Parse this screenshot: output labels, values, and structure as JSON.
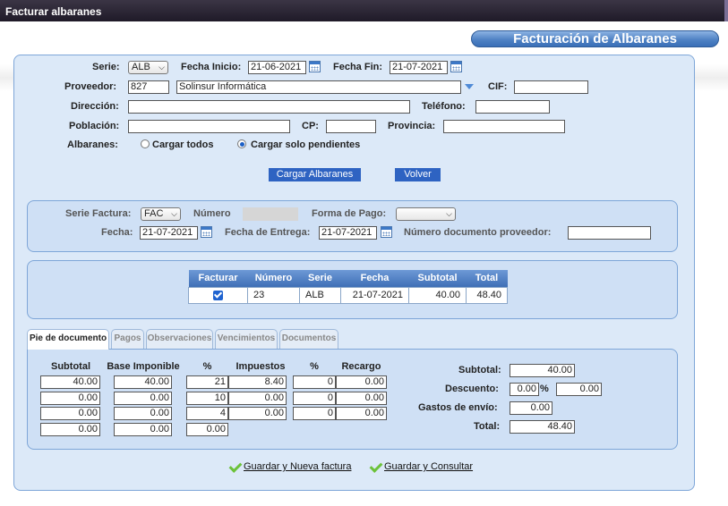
{
  "window": {
    "title": "Facturar albaranes"
  },
  "header": {
    "title": "Facturación de Albaranes"
  },
  "filters": {
    "serie_label": "Serie:",
    "serie_value": "ALB",
    "fecha_inicio_label": "Fecha Inicio:",
    "fecha_inicio": "21-06-2021",
    "fecha_fin_label": "Fecha Fin:",
    "fecha_fin": "21-07-2021",
    "proveedor_label": "Proveedor:",
    "proveedor_code": "827",
    "proveedor_name": "Solinsur Informática",
    "cif_label": "CIF:",
    "cif": "",
    "direccion_label": "Dirección:",
    "direccion": "",
    "telefono_label": "Teléfono:",
    "telefono": "",
    "poblacion_label": "Población:",
    "poblacion": "",
    "cp_label": "CP:",
    "cp": "",
    "provincia_label": "Provincia:",
    "provincia": "",
    "albaranes_label": "Albaranes:",
    "radio_todos": "Cargar todos",
    "radio_pendientes": "Cargar solo pendientes",
    "selected_radio": "pendientes",
    "cargar_button": "Cargar Albaranes",
    "volver_button": "Volver"
  },
  "invoice": {
    "serie_factura_label": "Serie Factura:",
    "serie_factura": "FAC",
    "numero_label": "Número",
    "forma_pago_label": "Forma de Pago:",
    "forma_pago": "",
    "fecha_label": "Fecha:",
    "fecha": "21-07-2021",
    "fecha_entrega_label": "Fecha de Entrega:",
    "fecha_entrega": "21-07-2021",
    "num_doc_label": "Número documento proveedor:",
    "num_doc": ""
  },
  "albaranes_table": {
    "headers": [
      "Facturar",
      "Número",
      "Serie",
      "Fecha",
      "Subtotal",
      "Total"
    ],
    "rows": [
      {
        "facturar": true,
        "numero": "23",
        "serie": "ALB",
        "fecha": "21-07-2021",
        "subtotal": "40.00",
        "total": "48.40"
      }
    ]
  },
  "tabs": [
    "Pie de documento",
    "Pagos",
    "Observaciones",
    "Vencimientos",
    "Documentos"
  ],
  "active_tab": 0,
  "pie": {
    "headers": [
      "Subtotal",
      "Base Imponible",
      "%",
      "Impuestos",
      "%",
      "Recargo"
    ],
    "rows": [
      [
        "40.00",
        "40.00",
        "21",
        "8.40",
        "0",
        "0.00"
      ],
      [
        "0.00",
        "0.00",
        "10",
        "0.00",
        "0",
        "0.00"
      ],
      [
        "0.00",
        "0.00",
        "4",
        "0.00",
        "0",
        "0.00"
      ]
    ],
    "total_row": [
      "0.00",
      "0.00",
      "0.00"
    ],
    "summary": {
      "subtotal_label": "Subtotal:",
      "subtotal": "40.00",
      "descuento_label": "Descuento:",
      "descuento_pct": "0.00",
      "pct_sign": "%",
      "descuento": "0.00",
      "gastos_label": "Gastos de envío:",
      "gastos": "0.00",
      "total_label": "Total:",
      "total": "48.40"
    }
  },
  "actions": {
    "guardar_nueva": "Guardar y Nueva factura",
    "guardar_consultar": "Guardar y Consultar"
  },
  "colors": {
    "accent": "#2e63c2",
    "panel_bg": "#dce9f8",
    "panel_border": "#7ea6d8",
    "titlebar": "#2a2433"
  }
}
